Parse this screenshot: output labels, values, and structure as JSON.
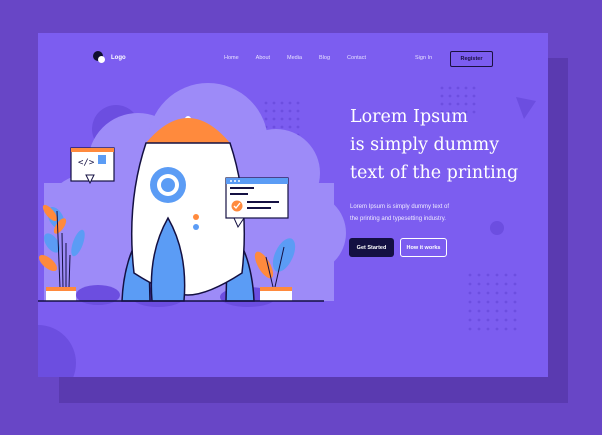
{
  "nav": {
    "logo": "Logo",
    "links": [
      "Home",
      "About",
      "Media",
      "Blog",
      "Contact"
    ],
    "sign_in": "Sign In",
    "register": "Register"
  },
  "hero": {
    "title_lines": [
      "Lorem Ipsum",
      "is simply dummy",
      "text of the printing"
    ],
    "subtitle_lines": [
      "Lorem Ipsum is simply dummy text of",
      "the printing and typesetting industry."
    ],
    "primary_button": "Get Started",
    "secondary_button": "How it works"
  },
  "colors": {
    "background": "#6846c6",
    "page": "#7c5df0",
    "accent_orange": "#ff8a3d",
    "accent_blue": "#5b9cf5",
    "dark": "#141042"
  }
}
